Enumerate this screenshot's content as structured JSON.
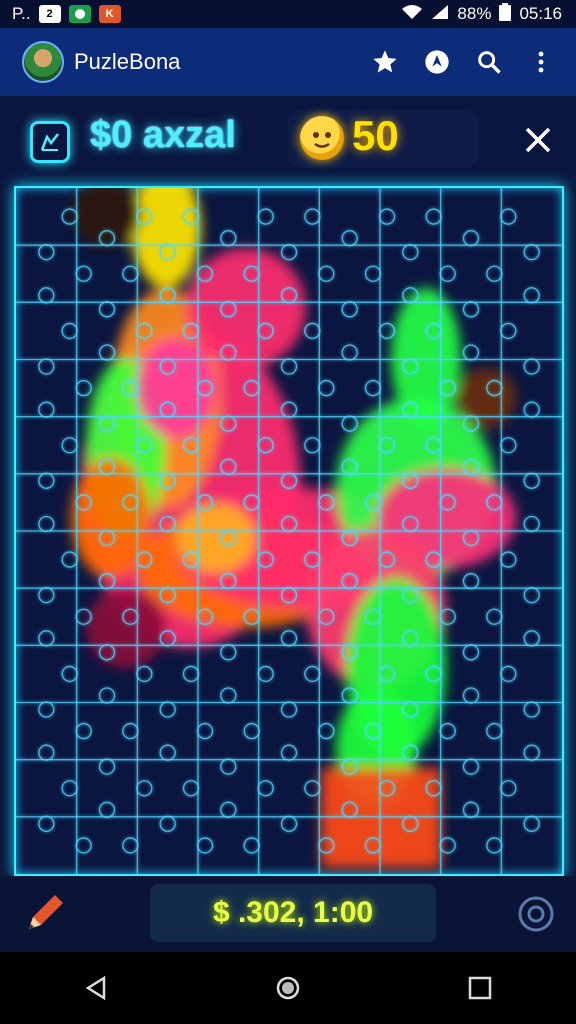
{
  "status_bar": {
    "carrier": "P..",
    "app_icon_labels": [
      "2",
      "",
      "K"
    ],
    "battery": "88%",
    "time": "05:16"
  },
  "app_bar": {
    "title": "PuzleBona",
    "icons": [
      "star-icon",
      "location-icon",
      "search-icon",
      "more-vert-icon"
    ]
  },
  "game_header": {
    "balance": "$0 axzal",
    "coins": "50"
  },
  "footer": {
    "score": "$ .302, 1:00"
  },
  "colors": {
    "neon_cyan": "#39f0ff",
    "coin_yellow": "#ffe100",
    "score_yellow": "#e9ff4a",
    "app_bar_blue": "#0c2b78",
    "board_bg": "#0b1640"
  }
}
